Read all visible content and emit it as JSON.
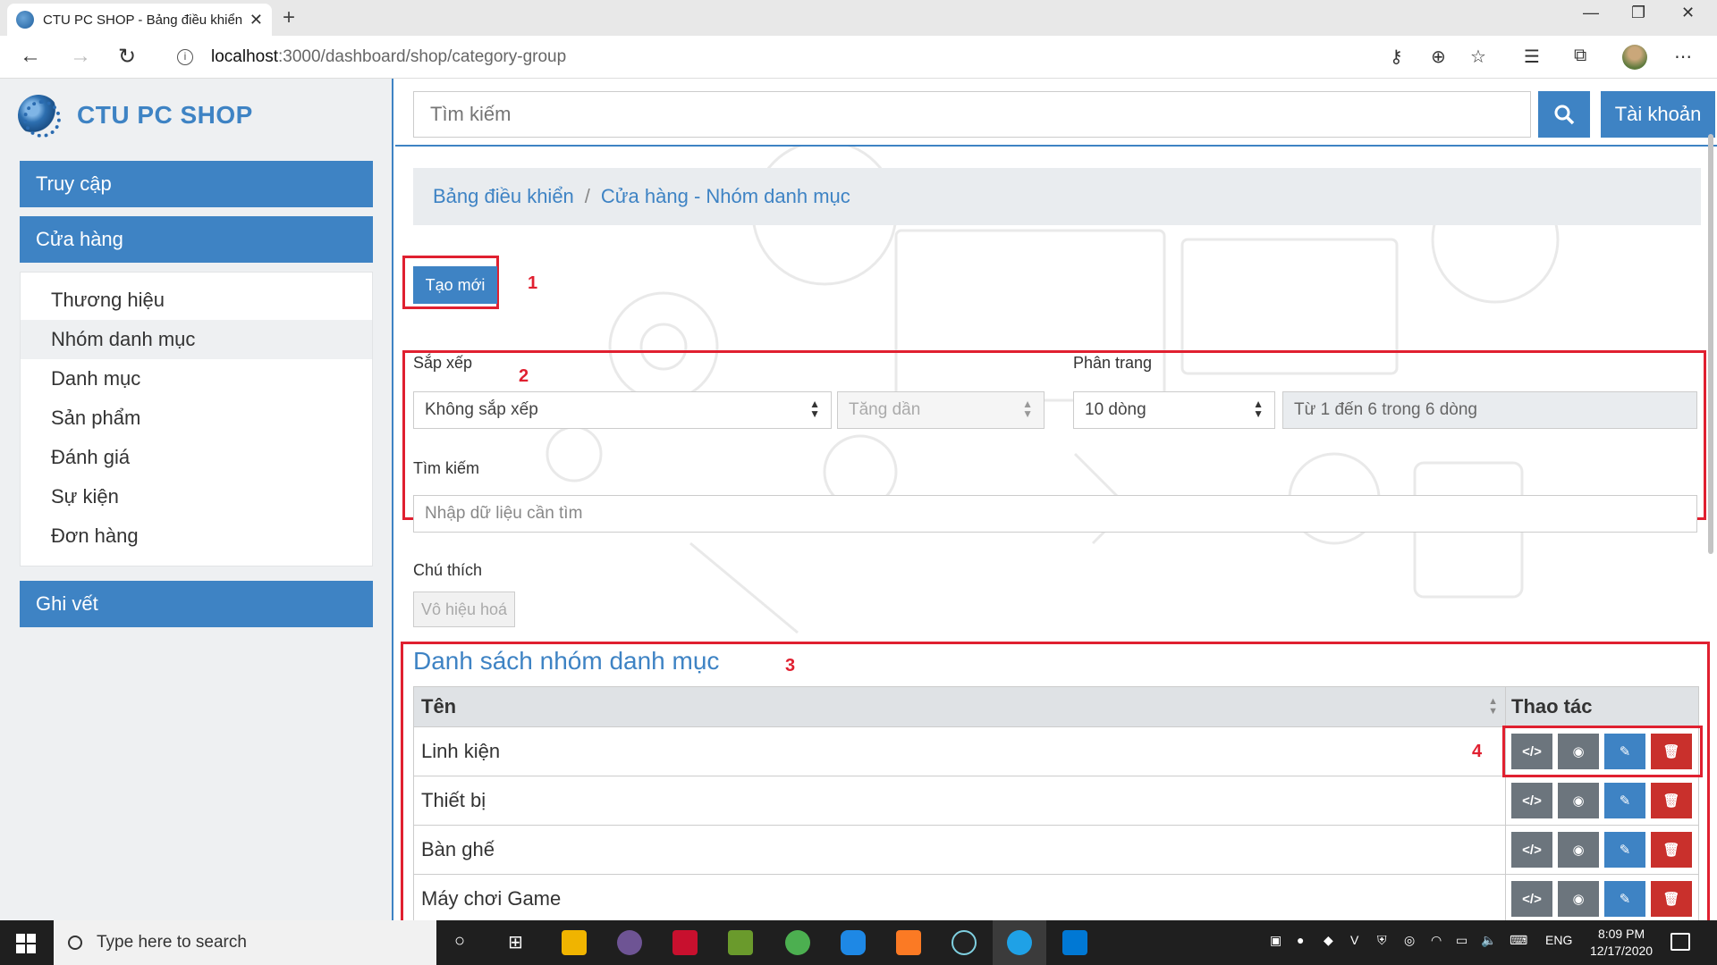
{
  "browser": {
    "tab_title": "CTU PC SHOP - Bảng điều khiển",
    "url_host": "localhost",
    "url_path": ":3000/dashboard/shop/category-group"
  },
  "sidebar": {
    "brand": "CTU PC SHOP",
    "menu": {
      "access": "Truy cập",
      "shop": "Cửa hàng",
      "log": "Ghi vết"
    },
    "sub_items": [
      {
        "label": "Thương hiệu"
      },
      {
        "label": "Nhóm danh mục",
        "active": true
      },
      {
        "label": "Danh mục"
      },
      {
        "label": "Sản phẩm"
      },
      {
        "label": "Đánh giá"
      },
      {
        "label": "Sự kiện"
      },
      {
        "label": "Đơn hàng"
      }
    ]
  },
  "topbar": {
    "search_placeholder": "Tìm kiếm",
    "account_label": "Tài khoản"
  },
  "breadcrumb": {
    "items": [
      "Bảng điều khiển",
      "Cửa hàng - Nhóm danh mục"
    ],
    "separator": "/"
  },
  "annotations": [
    "1",
    "2",
    "3",
    "4"
  ],
  "controls": {
    "create_label": "Tạo mới",
    "sort_label": "Sắp xếp",
    "sort_value": "Không sắp xếp",
    "order_value": "Tăng dần",
    "pagination_label": "Phân trang",
    "page_size_value": "10 dòng",
    "page_info": "Từ 1 đến 6 trong 6 dòng",
    "filter_label": "Tìm kiếm",
    "filter_placeholder": "Nhập dữ liệu cần tìm",
    "note_label": "Chú thích",
    "note_button": "Vô hiệu hoá"
  },
  "list": {
    "title": "Danh sách nhóm danh mục",
    "col_name": "Tên",
    "col_actions": "Thao tác",
    "rows": [
      {
        "name": "Linh kiện"
      },
      {
        "name": "Thiết bị"
      },
      {
        "name": "Bàn ghế"
      },
      {
        "name": "Máy chơi Game"
      }
    ]
  },
  "taskbar": {
    "search_placeholder": "Type here to search",
    "language": "ENG",
    "time": "8:09 PM",
    "date": "12/17/2020"
  },
  "colors": {
    "primary": "#3e83c4",
    "danger": "#c9302c",
    "secondary": "#6c757d",
    "annotation": "#e02030"
  }
}
